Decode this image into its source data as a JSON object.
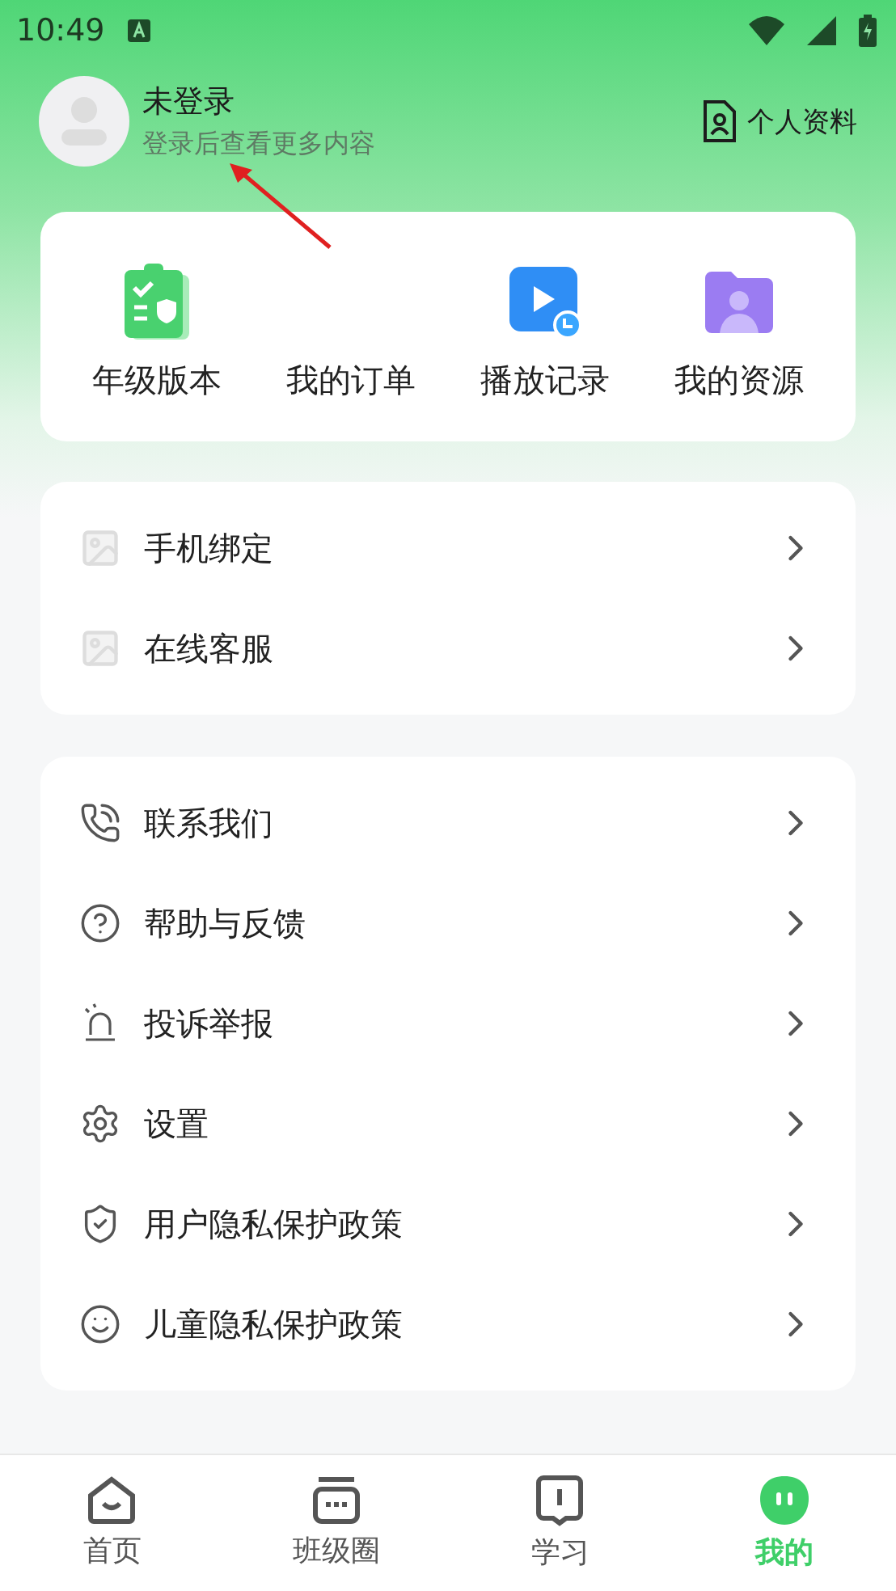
{
  "status_bar": {
    "time": "10:49"
  },
  "profile": {
    "name": "未登录",
    "hint": "登录后查看更多内容",
    "profile_link": "个人资料"
  },
  "shortcuts": [
    {
      "label": "年级版本",
      "kind": "grade"
    },
    {
      "label": "我的订单",
      "kind": "none"
    },
    {
      "label": "播放记录",
      "kind": "video"
    },
    {
      "label": "我的资源",
      "kind": "folder"
    }
  ],
  "account_menu": [
    {
      "label": "手机绑定"
    },
    {
      "label": "在线客服"
    }
  ],
  "service_menu": [
    {
      "label": "联系我们"
    },
    {
      "label": "帮助与反馈"
    },
    {
      "label": "投诉举报"
    },
    {
      "label": "设置"
    },
    {
      "label": "用户隐私保护政策"
    },
    {
      "label": "儿童隐私保护政策"
    }
  ],
  "bottom_nav": [
    {
      "label": "首页",
      "selected": false
    },
    {
      "label": "班级圈",
      "selected": false
    },
    {
      "label": "学习",
      "selected": false
    },
    {
      "label": "我的",
      "selected": true
    }
  ]
}
